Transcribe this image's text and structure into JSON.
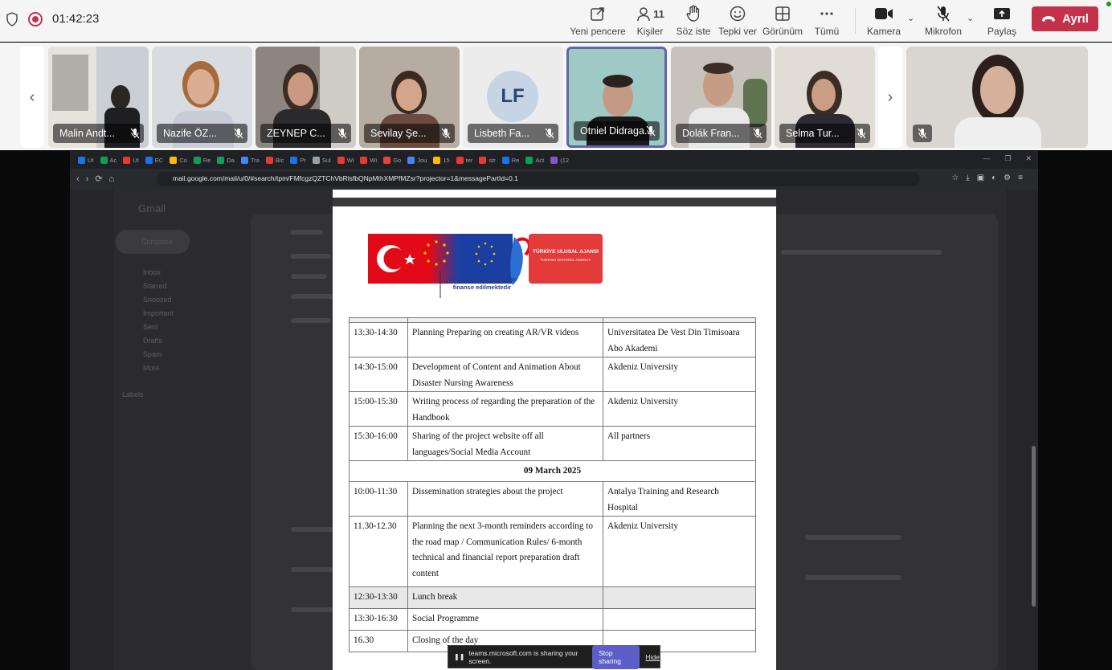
{
  "meeting": {
    "timer": "01:42:23",
    "toolbar": {
      "new_window": "Yeni pencere",
      "people_count": "11",
      "people": "Kişiler",
      "raise_hand": "Söz iste",
      "react": "Tepki ver",
      "view": "Görünüm",
      "more": "Tümü",
      "camera": "Kamera",
      "mic": "Mikrofon",
      "share": "Paylaş",
      "leave": "Ayrıl"
    },
    "participants": [
      {
        "name": "Malin Andt..."
      },
      {
        "name": "Nazife ÖZ..."
      },
      {
        "name": "ZEYNEP C..."
      },
      {
        "name": "Sevilay Şe..."
      },
      {
        "name": "Lisbeth Fa...",
        "initials": "LF"
      },
      {
        "name": "Otniel Didraga..."
      },
      {
        "name": "Dolák Fran..."
      },
      {
        "name": "Selma Tur..."
      }
    ]
  },
  "browser": {
    "tabs": [
      "Ut",
      "Ac",
      "Ut",
      "EC",
      "Co",
      "Re",
      "Da",
      "Tra",
      "Bic",
      "Pr",
      "Sul",
      "Wi",
      "Wi",
      "Go",
      "Jou",
      "15",
      "ter",
      "str",
      "Re",
      "Act",
      "(12"
    ],
    "url": "mail.google.com/mail/u/0/#search/tpm/FMfcgzQZTChVbRlsfbQNpMthXMPfMZsr?projector=1&messagePartId=0.1"
  },
  "gmail_bg": {
    "app_name": "Gmail",
    "compose": "Compose",
    "folders": [
      "Inbox",
      "Starred",
      "Snoozed",
      "Important",
      "Sent",
      "Drafts",
      "Spam",
      "More"
    ],
    "labels_heading": "Labels"
  },
  "document": {
    "logo_text_1": "TÜRKİYE ULUSAL AJANSI",
    "logo_text_2": "TURKISH NATIONAL AGENCY",
    "logo_caption_1": "Avrupa Birliği tarafından",
    "logo_caption_2": "finanse edilmektedir",
    "rows": [
      {
        "time": "13:30-14:30",
        "activity": "Planning Preparing on creating AR/VR videos",
        "responsible": "Universitatea De Vest Din Timisoara Abo Akademi"
      },
      {
        "time": "14:30-15:00",
        "activity": "Development of Content and Animation About Disaster Nursing Awareness",
        "responsible": "Akdeniz University"
      },
      {
        "time": "15:00-15:30",
        "activity": "Writing process of regarding the preparation of the Handbook",
        "responsible": "Akdeniz University"
      },
      {
        "time": "15:30-16:00",
        "activity": "Sharing of the project website off all languages/Social Media Account",
        "responsible": "All partners"
      }
    ],
    "date_row": "09 March 2025",
    "rows2": [
      {
        "time": "10:00-11:30",
        "activity": "Dissemination strategies about the project",
        "responsible": "Antalya Training and Research Hospital"
      },
      {
        "time": "11.30-12.30",
        "activity": "Planning the next 3-month reminders according to the road map / Communication Rules/ 6-month technical and financial report preparation draft content",
        "responsible": "Akdeniz University"
      },
      {
        "time": "12:30-13:30",
        "activity": "Lunch break",
        "responsible": ""
      },
      {
        "time": "13:30-16:30",
        "activity": "Social Programme",
        "responsible": ""
      },
      {
        "time": "16.30",
        "activity": "Closing of the day",
        "responsible": ""
      }
    ]
  },
  "sharebar": {
    "message": "teams.microsoft.com is sharing your screen.",
    "stop": "Stop sharing",
    "hide": "Hide"
  }
}
